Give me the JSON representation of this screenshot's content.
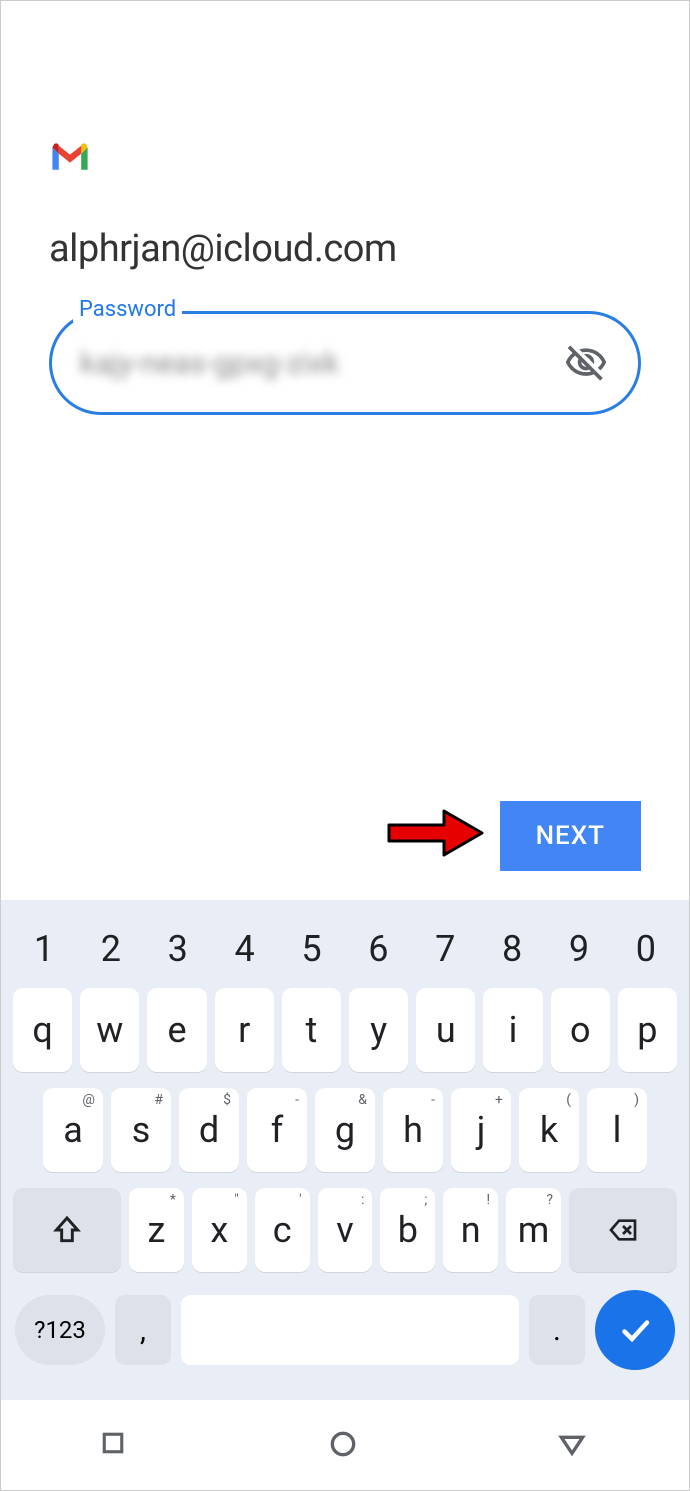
{
  "email": "alphrjan@icloud.com",
  "field": {
    "label": "Password",
    "value": "kajy-neas-gpxg-zixk"
  },
  "next_button": "NEXT",
  "keyboard": {
    "numbers": [
      "1",
      "2",
      "3",
      "4",
      "5",
      "6",
      "7",
      "8",
      "9",
      "0"
    ],
    "row1": [
      {
        "k": "q"
      },
      {
        "k": "w"
      },
      {
        "k": "e"
      },
      {
        "k": "r"
      },
      {
        "k": "t"
      },
      {
        "k": "y"
      },
      {
        "k": "u"
      },
      {
        "k": "i"
      },
      {
        "k": "o"
      },
      {
        "k": "p"
      }
    ],
    "row2": [
      {
        "k": "a",
        "s": "@"
      },
      {
        "k": "s",
        "s": "#"
      },
      {
        "k": "d",
        "s": "$"
      },
      {
        "k": "f",
        "s": "-"
      },
      {
        "k": "g",
        "s": "&"
      },
      {
        "k": "h",
        "s": "-"
      },
      {
        "k": "j",
        "s": "+"
      },
      {
        "k": "k",
        "s": "("
      },
      {
        "k": "l",
        "s": ")"
      }
    ],
    "row3": [
      {
        "k": "z",
        "s": "*"
      },
      {
        "k": "x",
        "s": "\""
      },
      {
        "k": "c",
        "s": "'"
      },
      {
        "k": "v",
        "s": ":"
      },
      {
        "k": "b",
        "s": ";"
      },
      {
        "k": "n",
        "s": "!"
      },
      {
        "k": "m",
        "s": "?"
      }
    ],
    "sym": "?123",
    "comma": ",",
    "period": "."
  }
}
